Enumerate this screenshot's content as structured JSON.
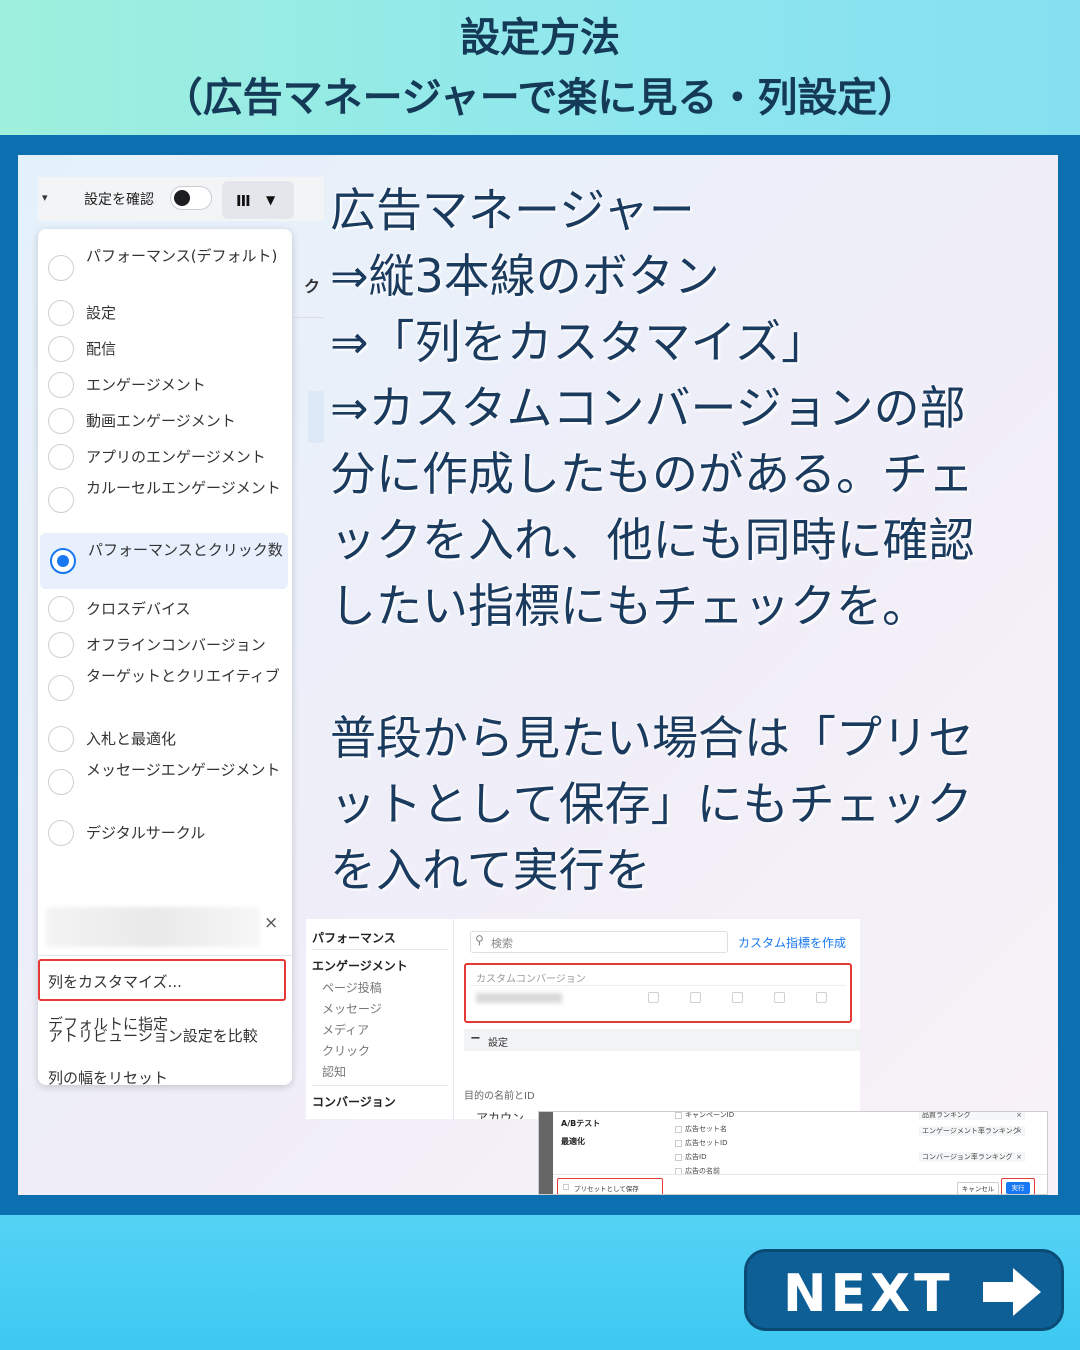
{
  "header": {
    "title_line1": "設定方法",
    "title_line2": "（広告マネージャーで楽に見る・列設定）"
  },
  "toolbar": {
    "confirm_label": "設定を確認",
    "columns_icon": "III"
  },
  "menu": {
    "options": [
      {
        "label": "パフォーマンス(デフォルト)",
        "selected": false
      },
      {
        "label": "設定",
        "selected": false
      },
      {
        "label": "配信",
        "selected": false
      },
      {
        "label": "エンゲージメント",
        "selected": false
      },
      {
        "label": "動画エンゲージメント",
        "selected": false
      },
      {
        "label": "アプリのエンゲージメント",
        "selected": false
      },
      {
        "label": "カルーセルエンゲージメント",
        "selected": false
      },
      {
        "label": "パフォーマンスとクリック数",
        "selected": true
      },
      {
        "label": "クロスデバイス",
        "selected": false
      },
      {
        "label": "オフラインコンバージョン",
        "selected": false
      },
      {
        "label": "ターゲットとクリエイティブ",
        "selected": false
      },
      {
        "label": "入札と最適化",
        "selected": false
      },
      {
        "label": "メッセージエンゲージメント",
        "selected": false
      },
      {
        "label": "デジタルサークル",
        "selected": false
      }
    ],
    "close_symbol": "×",
    "actions": {
      "customize": "列をカスタマイズ...",
      "set_default": "デフォルトに指定",
      "compare_attribution": "アトリビューション設定を比較",
      "reset_width": "列の幅をリセット"
    }
  },
  "instructions": {
    "lines": [
      "広告マネージャー",
      "⇒縦3本線のボタン",
      "⇒「列をカスタマイズ」",
      "⇒カスタムコンバージョンの部",
      "分に作成したものがある。チェ",
      "ックを入れ、他にも同時に確認",
      "したい指標にもチェックを。",
      "",
      "普段から見たい場合は「プリセ",
      "ットとして保存」にもチェック",
      "を入れて実行を"
    ]
  },
  "customize_dialog": {
    "sidebar": {
      "performance": "パフォーマンス",
      "engagement": "エンゲージメント",
      "engagement_items": [
        "ページ投稿",
        "メッセージ",
        "メディア",
        "クリック",
        "認知"
      ],
      "conversion": "コンバージョン"
    },
    "search_placeholder": "検索",
    "create_metric_link": "カスタム指標を作成",
    "custom_conversion_label": "カスタムコンバージョン",
    "settings_label": "設定",
    "footer_label": "目的の名前とID",
    "footer_partial": "アカウン"
  },
  "save_dialog": {
    "nav": [
      "A/Bテスト",
      "最適化"
    ],
    "items": [
      "キャンペーンID",
      "広告セット名",
      "広告セットID",
      "広告ID",
      "広告の名前"
    ],
    "chips": [
      "品質ランキング",
      "エンゲージメント率ランキング",
      "コンバージョン率ランキング"
    ],
    "preset_label": "プリセットとして保存",
    "cancel_label": "キャンセル",
    "run_label": "実行"
  },
  "next_button": {
    "label": "NEXT"
  },
  "colors": {
    "frame_blue": "#0c6fb0",
    "accent_blue": "#1877f2",
    "highlight_red": "#e53935",
    "text_navy": "#1a3a5e"
  }
}
